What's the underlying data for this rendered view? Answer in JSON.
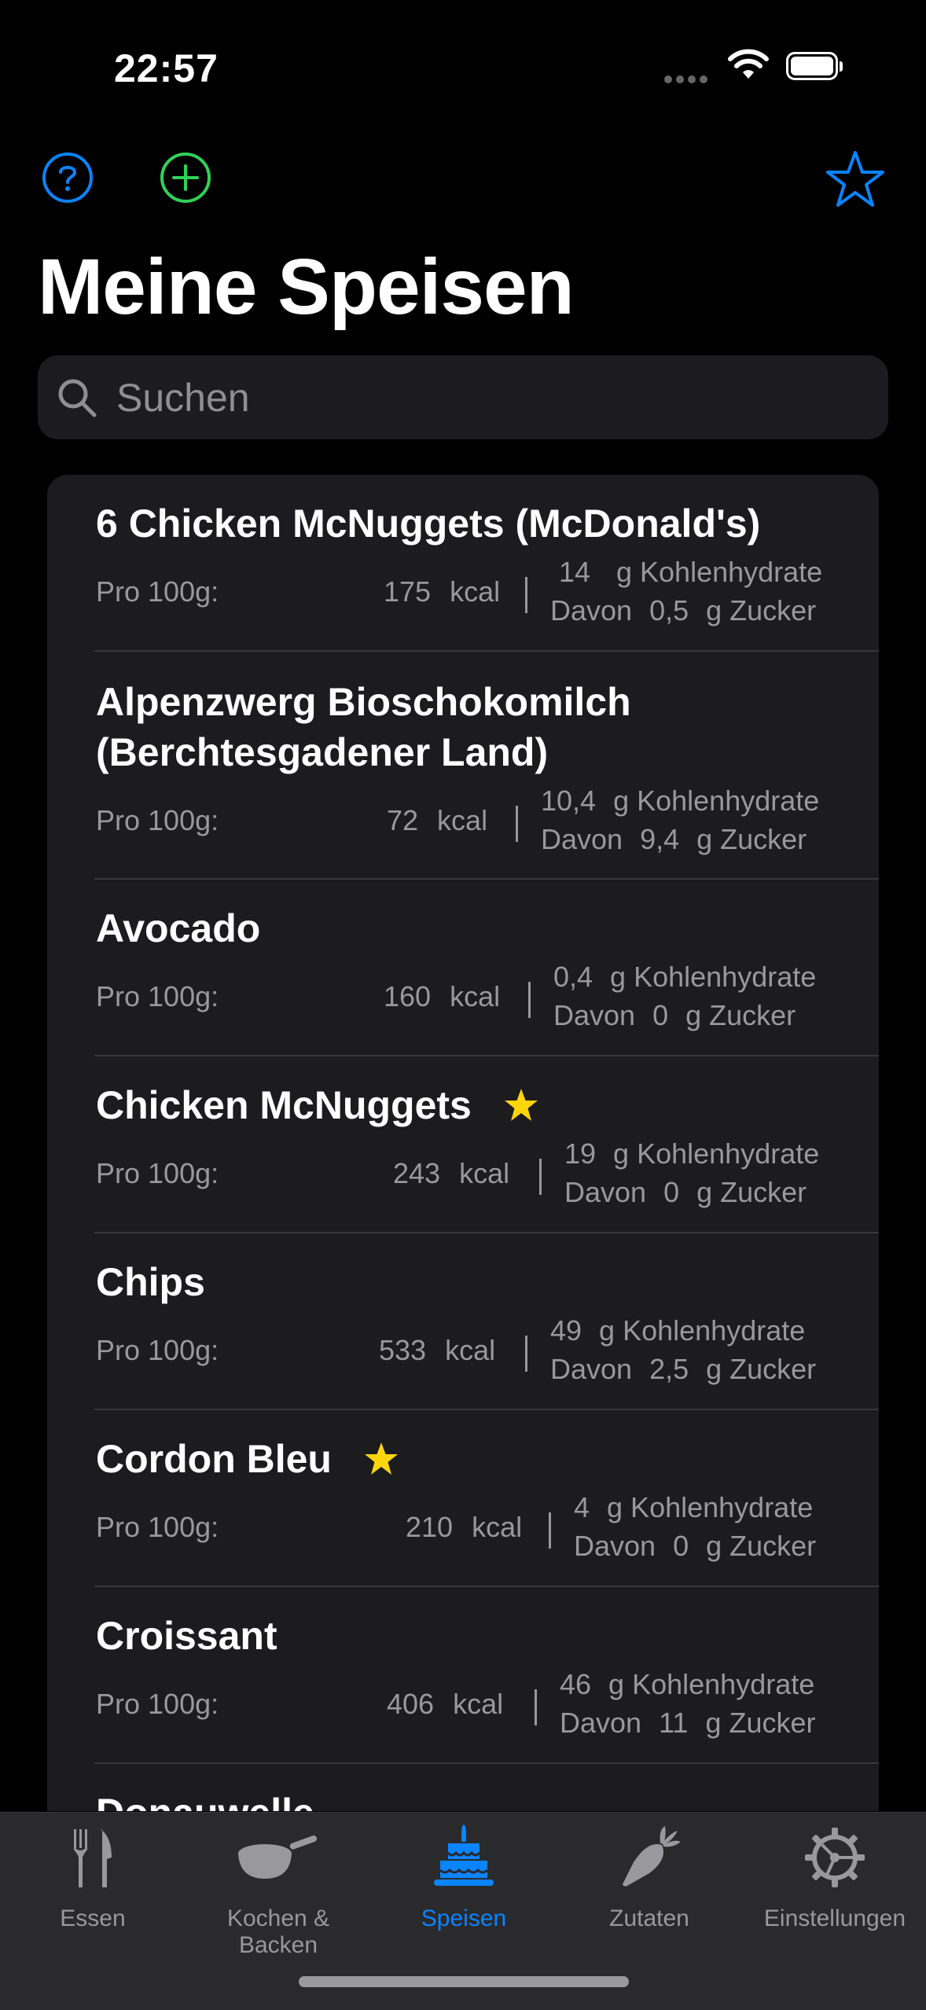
{
  "status_bar": {
    "time": "22:57"
  },
  "nav": {
    "title": "Meine Speisen"
  },
  "search": {
    "placeholder": "Suchen"
  },
  "colors": {
    "accent": "#0a84ff",
    "add": "#30d158",
    "star": "#ffd60a",
    "secondary_text": "#98989d"
  },
  "icons": [
    "help-icon",
    "add-icon",
    "favorites-star-icon",
    "search-icon",
    "fork-knife-icon",
    "frying-pan-icon",
    "cake-icon",
    "carrot-icon",
    "gear-icon"
  ],
  "list": {
    "per_label": "Pro 100g:",
    "kcal_unit": "kcal",
    "carb_unit": "g Kohlenhydrate",
    "sugar_prefix": "Davon",
    "sugar_unit": "g Zucker",
    "items": [
      {
        "name": "6 Chicken McNuggets (McDonald's)",
        "favorite": false,
        "kcal": "175",
        "carbs": "14",
        "sugar": "0,5"
      },
      {
        "name": "Alpenzwerg Bioschokomilch",
        "name2": "(Berchtesgadener Land)",
        "favorite": false,
        "kcal": "72",
        "carbs": "10,4",
        "sugar": "9,4"
      },
      {
        "name": "Avocado",
        "favorite": false,
        "kcal": "160",
        "carbs": "0,4",
        "sugar": "0"
      },
      {
        "name": "Chicken McNuggets",
        "favorite": true,
        "kcal": "243",
        "carbs": "19",
        "sugar": "0"
      },
      {
        "name": "Chips",
        "favorite": false,
        "kcal": "533",
        "carbs": "49",
        "sugar": "2,5"
      },
      {
        "name": "Cordon Bleu",
        "favorite": true,
        "kcal": "210",
        "carbs": "4",
        "sugar": "0"
      },
      {
        "name": "Croissant",
        "favorite": false,
        "kcal": "406",
        "carbs": "46",
        "sugar": "11"
      },
      {
        "name": "Donauwelle",
        "favorite": false
      }
    ]
  },
  "tabs": [
    {
      "label": "Essen",
      "icon": "fork-knife-icon",
      "active": false
    },
    {
      "label": "Kochen & Backen",
      "icon": "frying-pan-icon",
      "active": false
    },
    {
      "label": "Speisen",
      "icon": "cake-icon",
      "active": true
    },
    {
      "label": "Zutaten",
      "icon": "carrot-icon",
      "active": false
    },
    {
      "label": "Einstellungen",
      "icon": "gear-icon",
      "active": false
    }
  ]
}
